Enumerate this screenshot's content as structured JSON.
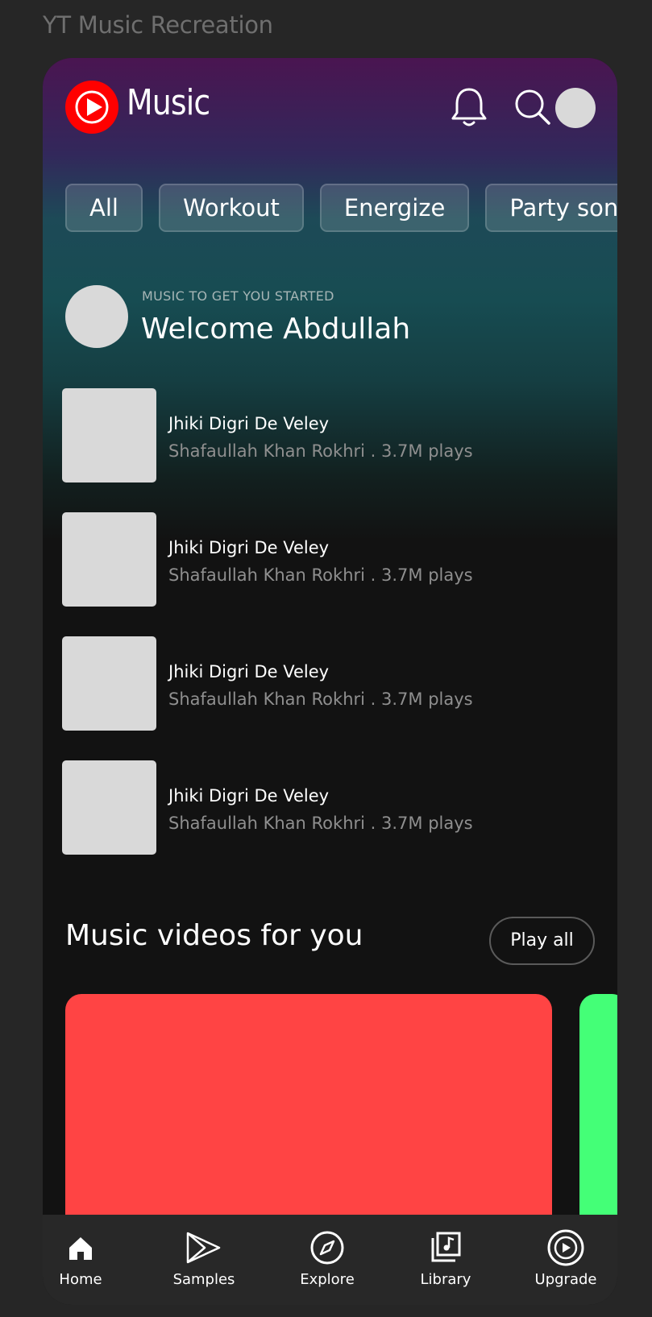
{
  "window": {
    "title": "YT Music Recreation"
  },
  "header": {
    "logo_text": "Music",
    "icons": [
      "youtube-music-logo-icon",
      "bell-icon",
      "search-icon"
    ]
  },
  "chips": [
    {
      "label": "All"
    },
    {
      "label": "Workout"
    },
    {
      "label": "Energize"
    },
    {
      "label": "Party song"
    }
  ],
  "welcome": {
    "kicker": "MUSIC TO GET YOU STARTED",
    "title": "Welcome Abdullah"
  },
  "songs": [
    {
      "title": "Jhiki Digri De Veley",
      "meta": "Shafaullah Khan Rokhri . 3.7M plays"
    },
    {
      "title": "Jhiki Digri De Veley",
      "meta": "Shafaullah Khan Rokhri . 3.7M plays"
    },
    {
      "title": "Jhiki Digri De Veley",
      "meta": "Shafaullah Khan Rokhri . 3.7M plays"
    },
    {
      "title": "Jhiki Digri De Veley",
      "meta": "Shafaullah Khan Rokhri . 3.7M plays"
    }
  ],
  "music_videos": {
    "title": "Music videos for you",
    "play_all_label": "Play all",
    "cards": [
      {
        "color": "#ff4444"
      },
      {
        "color": "#44ff77"
      }
    ]
  },
  "bottom_nav": {
    "items": [
      {
        "label": "Home",
        "icon": "home-icon",
        "active": true
      },
      {
        "label": "Samples",
        "icon": "samples-icon",
        "active": false
      },
      {
        "label": "Explore",
        "icon": "compass-icon",
        "active": false
      },
      {
        "label": "Library",
        "icon": "library-icon",
        "active": false
      },
      {
        "label": "Upgrade",
        "icon": "upgrade-icon",
        "active": false
      }
    ]
  },
  "colors": {
    "brand_red": "#ff0000",
    "background": "#121212",
    "nav_background": "#282828",
    "thumbnail_placeholder": "#d9d9d9",
    "secondary_text": "#8f8f8f"
  }
}
